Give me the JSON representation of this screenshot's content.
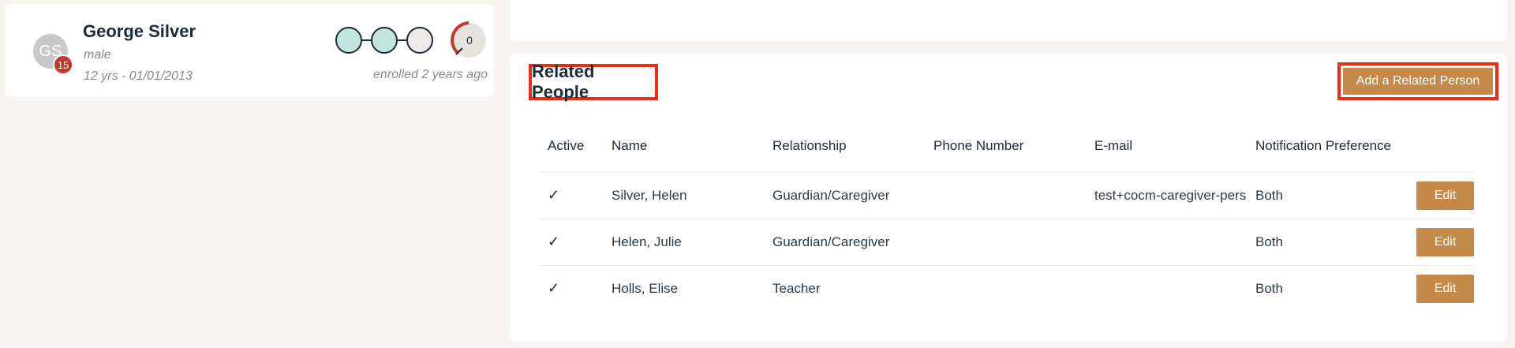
{
  "patient": {
    "initials": "GS",
    "age_badge": "15",
    "name": "George Silver",
    "gender": "male",
    "age_dob": "12 yrs - 01/01/2013",
    "enrolled": "enrolled 2 years ago",
    "gauge_value": "0",
    "step_colors": [
      "#c3e4dc",
      "#c3e4dc",
      "#eeeaea"
    ]
  },
  "related_people": {
    "title": "Related People",
    "add_button": "Add a Related Person",
    "columns": [
      "Active",
      "Name",
      "Relationship",
      "Phone Number",
      "E-mail",
      "Notification Preference"
    ],
    "rows": [
      {
        "active": "✓",
        "name": "Silver, Helen",
        "relationship": "Guardian/Caregiver",
        "phone": "",
        "email": "test+cocm-caregiver-pers",
        "notification": "Both",
        "action": "Edit"
      },
      {
        "active": "✓",
        "name": "Helen, Julie",
        "relationship": "Guardian/Caregiver",
        "phone": "",
        "email": "",
        "notification": "Both",
        "action": "Edit"
      },
      {
        "active": "✓",
        "name": "Holls, Elise",
        "relationship": "Teacher",
        "phone": "",
        "email": "",
        "notification": "Both",
        "action": "Edit"
      }
    ]
  },
  "colors": {
    "accent": "#c58a49",
    "highlight": "#ea2e14",
    "badge": "#c0392b",
    "gauge_arc": "#c0392b"
  }
}
